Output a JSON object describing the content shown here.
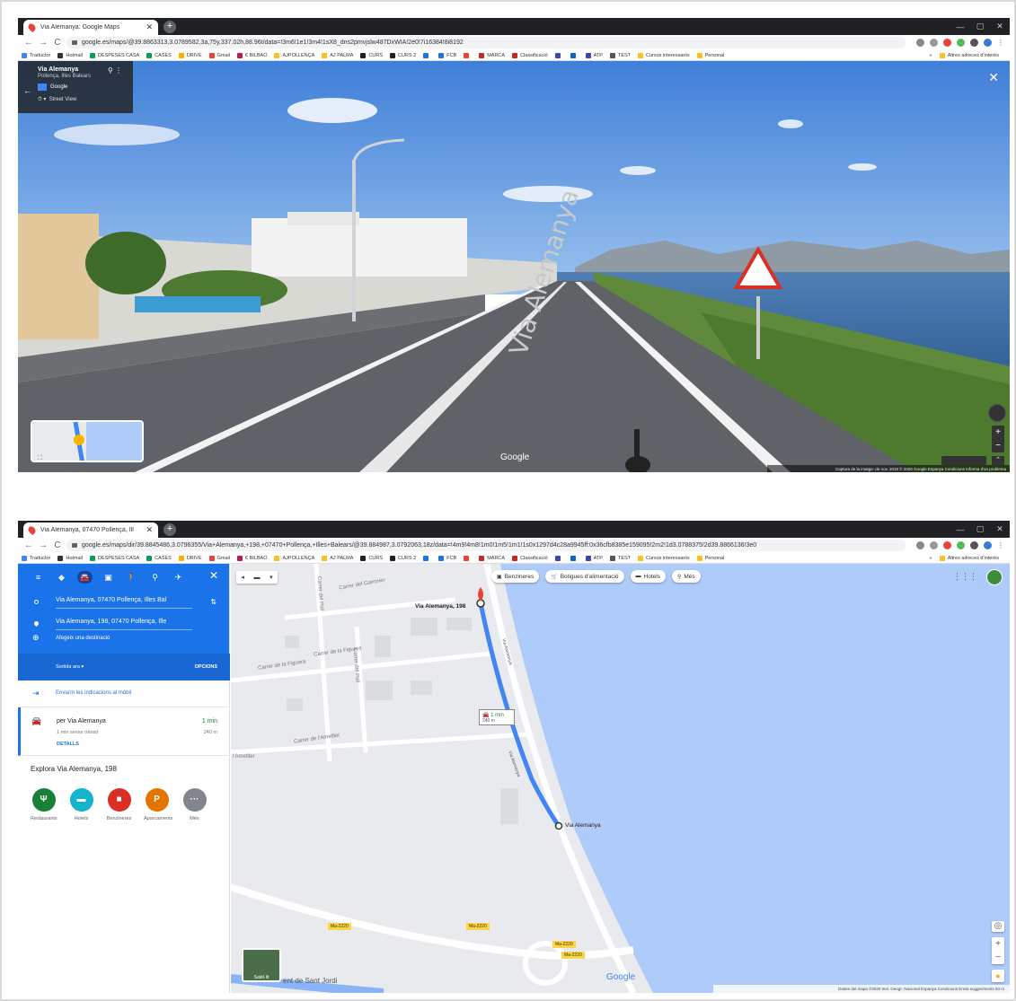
{
  "browser": {
    "window_controls": {
      "minimize": "—",
      "maximize": "▢",
      "close": "✕"
    },
    "nav": {
      "back": "←",
      "forward": "→",
      "reload": "C"
    },
    "bookmarks": [
      {
        "label": "Traductor",
        "color": "#4285f4"
      },
      {
        "label": "Hotmail",
        "color": "#333333"
      },
      {
        "label": "DESPESES CASA",
        "color": "#0f9d58"
      },
      {
        "label": "CASES",
        "color": "#0f9d58"
      },
      {
        "label": "DRIVE",
        "color": "#f4b400"
      },
      {
        "label": "Gmail",
        "color": "#ea4335"
      },
      {
        "label": "€ BILBAO",
        "color": "#c2185b"
      },
      {
        "label": "AJPOLLENÇA",
        "color": "#f6c026"
      },
      {
        "label": "AJ PALMA",
        "color": "#f6c026"
      },
      {
        "label": "CURS",
        "color": "#222222"
      },
      {
        "label": "CURS 2",
        "color": "#222222"
      },
      {
        "label": "",
        "color": "#1a73e8"
      },
      {
        "label": "FCB",
        "color": "#1a73e8"
      },
      {
        "label": "",
        "color": "#ea4335"
      },
      {
        "label": "MARCA",
        "color": "#c62828"
      },
      {
        "label": "Classificació",
        "color": "#c62828"
      },
      {
        "label": "",
        "color": "#3949ab"
      },
      {
        "label": "",
        "color": "#0a66c2"
      },
      {
        "label": "ATP",
        "color": "#3949ab"
      },
      {
        "label": "TEST",
        "color": "#555555"
      },
      {
        "label": "Cursos interessants",
        "color": "#f6c026"
      },
      {
        "label": "Personal",
        "color": "#f6c026"
      }
    ],
    "bookmarks_more": "»",
    "other_bookmarks": "Altres adreces d'interès"
  },
  "window1": {
    "tab_title": "Via Alemanya: Google Maps",
    "url": "google.es/maps/@39.8863313,3.0789582,3a,75y,337.02h,88.96t/data=!3m6!1e1!3m4!1sX8_dns2pmvjslw487DxWIA!2e0!7i16384!8i8192",
    "streetview": {
      "place_title": "Via Alemanya",
      "place_subtitle": "Pollença, Illes Balears",
      "brand": "Google",
      "mode_label": "Street View",
      "road_text": "Via Alemanya",
      "watermark": "Google",
      "footer": "Captura de la imatge: de nov. 2018   © 2020 Google   Espanya   Condicions   Informa d'un problema"
    }
  },
  "window2": {
    "tab_title": "Via Alemanya, 07470 Pollença, Ill",
    "url": "google.es/maps/dir/39.8845486,3.0796355/Via+Alemanya,+198,+07470+Pollença,+Illes+Balears/@39.884987,3.0792063,18z/data=!4m9!4m8!1m0!1m5!1m1!1s0x1297d4c28a9945ff:0x36cfb8385e159095!2m2!1d3.0788375!2d39.8866136!3e0",
    "directions": {
      "origin": "Via Alemanya, 07470 Pollença, Illes Bal",
      "destination": "Via Alemanya, 198, 07470 Pollença, Ille",
      "add_destination": "Afegeix una destinació",
      "depart_label": "Sortida ara",
      "options_label": "OPCIONS",
      "send_to_phone": "Envia'm les indicacions al mòbil",
      "route_via": "per Via Alemanya",
      "route_time": "1 min",
      "route_traffic": "1 min sense trànsit",
      "route_distance": "240 m",
      "details": "DETALLS",
      "explore_title": "Explora Via Alemanya, 198",
      "categories": [
        {
          "label": "Restaurants",
          "glyph": "Ψ",
          "color": "#188038"
        },
        {
          "label": "Hotels",
          "glyph": "▬",
          "color": "#12b5cb"
        },
        {
          "label": "Benzineres",
          "glyph": "■",
          "color": "#d93025"
        },
        {
          "label": "Aparcaments",
          "glyph": "P",
          "color": "#e37400"
        },
        {
          "label": "Més",
          "glyph": "···",
          "color": "#80868b"
        }
      ]
    },
    "map": {
      "chips": [
        "Benzineres",
        "Botigues d'alimentació",
        "Hotels",
        "Més"
      ],
      "streets": {
        "garrover": "Carrer del Garrover",
        "figuera1": "Carrer de la Figuera",
        "figuera2": "Carrer de la Figuera",
        "poll1": "Carrer del Poll",
        "poll2": "Carrer del Poll",
        "ametller1": "Carrer de l'Ametller",
        "ametller2": "l'Ametller",
        "sant_jordi": "ent de Sant Jordi",
        "via_alemanya_road": "Via Alemanya"
      },
      "dest_label": "Via Alemanya, 198",
      "origin_label": "Via Alemanya",
      "route_box_time": "1 min",
      "route_box_dist": "240 m",
      "road_codes": [
        "Ma-2220",
        "Ma-2220",
        "Ma-2220",
        "Ma-2220"
      ],
      "satellite_label": "Satèl·lit",
      "watermark": "Google",
      "footer": "Dades del mapa ©2020 Inst. Geogr. Nacional   Espanya   Condicions   Envia suggeriments   50 m"
    }
  },
  "colors": {
    "maps_blue": "#1a73e8",
    "route_blue": "#4285f4",
    "water": "#aecbfa",
    "land": "#e8eaed",
    "pin_red": "#ea4335"
  }
}
